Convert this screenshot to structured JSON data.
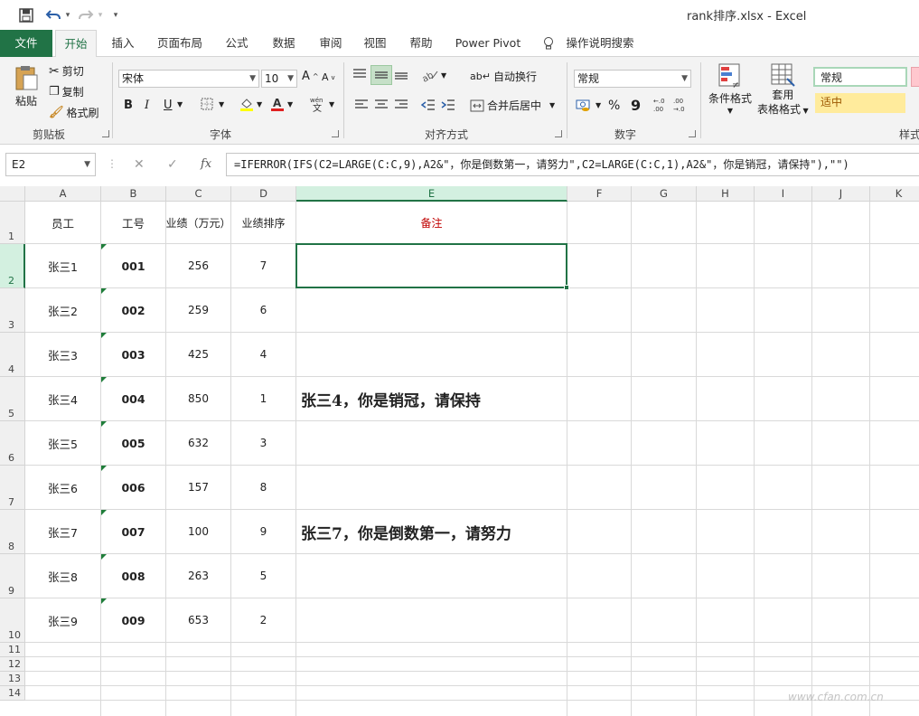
{
  "window": {
    "title": "rank排序.xlsx  -  Excel"
  },
  "qat": {
    "undo_arrow": "▾",
    "redo_arrow": "▾",
    "customize": "▾"
  },
  "tabs": {
    "file": "文件",
    "items": [
      "开始",
      "插入",
      "页面布局",
      "公式",
      "数据",
      "审阅",
      "视图",
      "帮助",
      "Power Pivot"
    ],
    "tell_me": "操作说明搜索"
  },
  "ribbon": {
    "clipboard": {
      "label": "剪贴板",
      "paste": "粘贴",
      "cut": "剪切",
      "copy": "复制",
      "format_painter": "格式刷"
    },
    "font": {
      "label": "字体",
      "name": "宋体",
      "size": "10",
      "bold": "B",
      "italic": "I",
      "underline": "U"
    },
    "alignment": {
      "label": "对齐方式",
      "wrap": "自动换行",
      "merge": "合并后居中"
    },
    "number": {
      "label": "数字",
      "format": "常规",
      "percent": "%",
      "comma": "9"
    },
    "styles": {
      "label": "样式",
      "conditional": "条件格式",
      "table_1": "套用",
      "table_2": "表格格式",
      "normal": "常规",
      "neutral": "适中"
    }
  },
  "formula_bar": {
    "name_box": "E2",
    "formula": "=IFERROR(IFS(C2=LARGE(C:C,9),A2&\"，你是倒数第一，请努力\",C2=LARGE(C:C,1),A2&\"，你是销冠，请保持\"),\"\")"
  },
  "grid": {
    "columns": [
      "A",
      "B",
      "C",
      "D",
      "E",
      "F",
      "G",
      "H",
      "I",
      "J",
      "K"
    ],
    "rows": [
      "1",
      "2",
      "3",
      "4",
      "5",
      "6",
      "7",
      "8",
      "9",
      "10",
      "11",
      "12",
      "13",
      "14"
    ],
    "headers": {
      "employee": "员工",
      "id": "工号",
      "sales": "业绩（万元）",
      "rank": "业绩排序",
      "note": "备注"
    },
    "data": [
      {
        "name": "张三1",
        "id": "001",
        "sales": "256",
        "rank": "7",
        "note": ""
      },
      {
        "name": "张三2",
        "id": "002",
        "sales": "259",
        "rank": "6",
        "note": ""
      },
      {
        "name": "张三3",
        "id": "003",
        "sales": "425",
        "rank": "4",
        "note": ""
      },
      {
        "name": "张三4",
        "id": "004",
        "sales": "850",
        "rank": "1",
        "note": "张三4，你是销冠，请保持"
      },
      {
        "name": "张三5",
        "id": "005",
        "sales": "632",
        "rank": "3",
        "note": ""
      },
      {
        "name": "张三6",
        "id": "006",
        "sales": "157",
        "rank": "8",
        "note": ""
      },
      {
        "name": "张三7",
        "id": "007",
        "sales": "100",
        "rank": "9",
        "note": "张三7，你是倒数第一，请努力"
      },
      {
        "name": "张三8",
        "id": "008",
        "sales": "263",
        "rank": "5",
        "note": ""
      },
      {
        "name": "张三9",
        "id": "009",
        "sales": "653",
        "rank": "2",
        "note": ""
      }
    ]
  },
  "watermark": "www.cfan.com.cn",
  "colors": {
    "accent": "#217346",
    "note_header": "#c00000",
    "neutral_style": "#ffeb9c"
  }
}
